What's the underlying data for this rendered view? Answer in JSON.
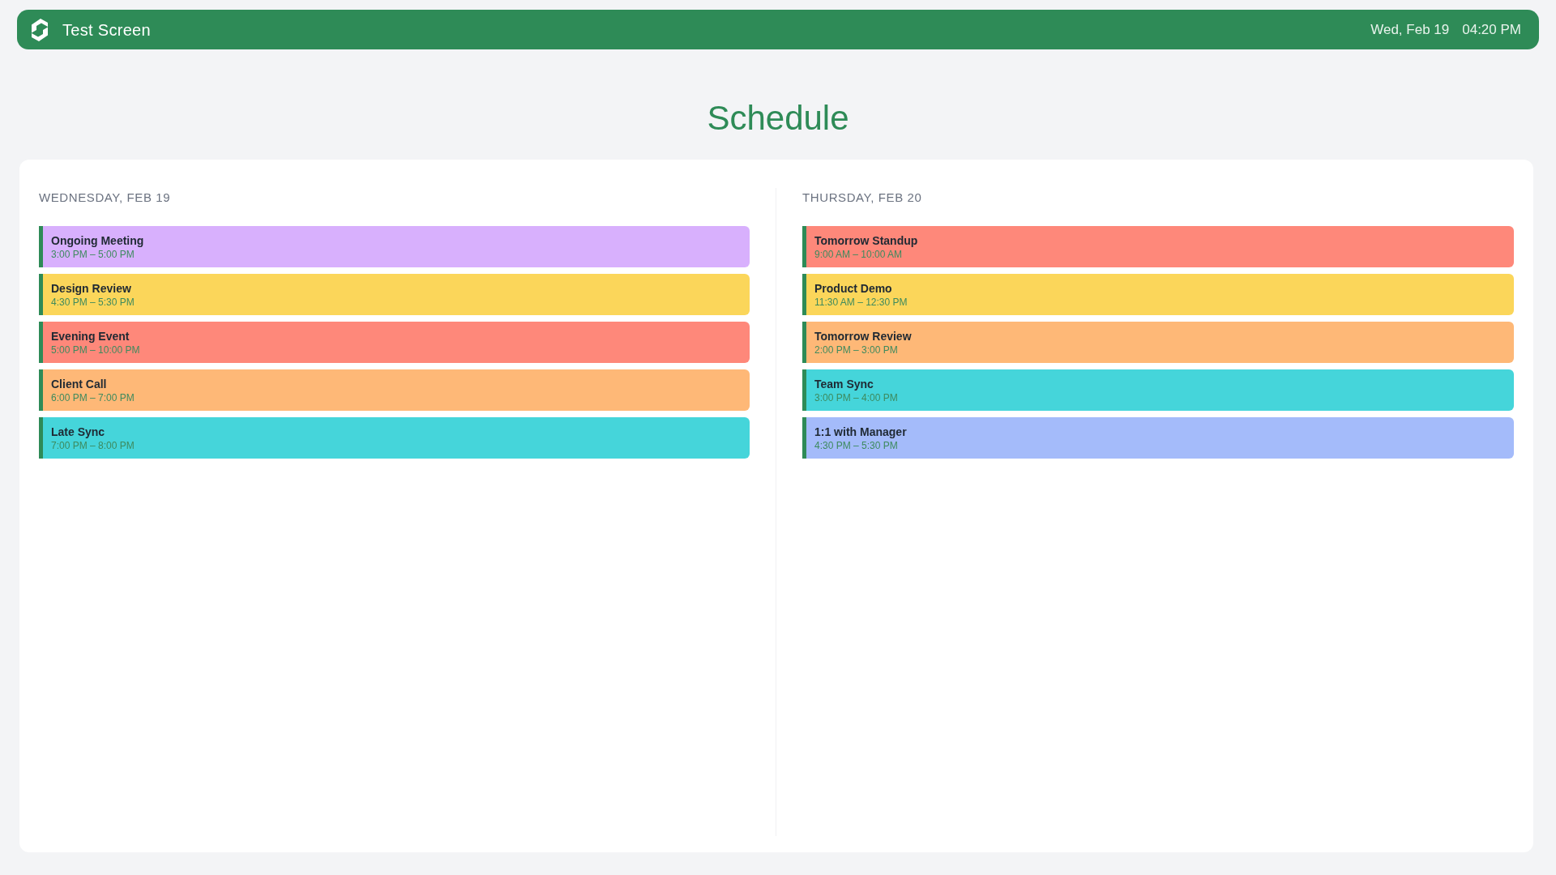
{
  "header": {
    "title": "Test Screen",
    "date": "Wed, Feb 19",
    "time": "04:20 PM"
  },
  "page_title": "Schedule",
  "days": [
    {
      "heading": "WEDNESDAY, FEB 19",
      "events": [
        {
          "title": "Ongoing Meeting",
          "time": "3:00 PM – 5:00 PM",
          "color": "#d8b0fd"
        },
        {
          "title": "Design Review",
          "time": "4:30 PM – 5:30 PM",
          "color": "#fbd65a"
        },
        {
          "title": "Evening Event",
          "time": "5:00 PM – 10:00 PM",
          "color": "#fe887a"
        },
        {
          "title": "Client Call",
          "time": "6:00 PM – 7:00 PM",
          "color": "#feb877"
        },
        {
          "title": "Late Sync",
          "time": "7:00 PM – 8:00 PM",
          "color": "#45d5da"
        }
      ]
    },
    {
      "heading": "THURSDAY, FEB 20",
      "events": [
        {
          "title": "Tomorrow Standup",
          "time": "9:00 AM – 10:00 AM",
          "color": "#fe887a"
        },
        {
          "title": "Product Demo",
          "time": "11:30 AM – 12:30 PM",
          "color": "#fbd65a"
        },
        {
          "title": "Tomorrow Review",
          "time": "2:00 PM – 3:00 PM",
          "color": "#feb877"
        },
        {
          "title": "Team Sync",
          "time": "3:00 PM – 4:00 PM",
          "color": "#45d5da"
        },
        {
          "title": "1:1 with Manager",
          "time": "4:30 PM – 5:30 PM",
          "color": "#a4bbfa"
        }
      ]
    }
  ]
}
